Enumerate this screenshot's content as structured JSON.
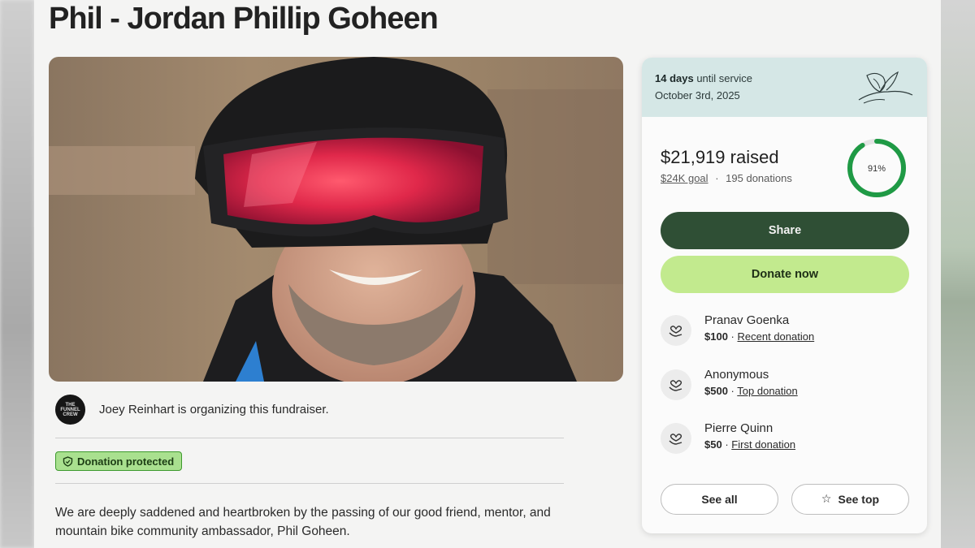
{
  "page": {
    "title": "Phil - Jordan Phillip Goheen"
  },
  "organizer": {
    "avatar_text": "THE FUNNEL CREW",
    "text": "Joey Reinhart is organizing this fundraiser."
  },
  "badge": {
    "label": "Donation protected",
    "color": "#a9e08f"
  },
  "story": {
    "text": "We are deeply saddened and heartbroken by the passing of our good friend, mentor, and mountain bike community ambassador, Phil Goheen."
  },
  "service": {
    "days": "14 days",
    "suffix": "until service",
    "date": "October 3rd, 2025"
  },
  "fundraiser": {
    "raised_amount": "$21,919",
    "raised_suffix": "raised",
    "goal": "$24K goal",
    "separator": "·",
    "donations": "195 donations",
    "percent_label": "91%",
    "progress_fraction": 0.91,
    "progress_color": "#1f9a45"
  },
  "actions": {
    "share_label": "Share",
    "donate_label": "Donate now",
    "see_all_label": "See all",
    "see_top_label": "See top"
  },
  "donors": [
    {
      "name": "Pranav Goenka",
      "amount": "$100",
      "sep": "·",
      "tag": "Recent donation"
    },
    {
      "name": "Anonymous",
      "amount": "$500",
      "sep": "·",
      "tag": "Top donation"
    },
    {
      "name": "Pierre Quinn",
      "amount": "$50",
      "sep": "·",
      "tag": "First donation"
    }
  ],
  "colors": {
    "share_button": "#2f4f35",
    "donate_button": "#c2ea8e",
    "service_header": "#d5e7e6"
  }
}
